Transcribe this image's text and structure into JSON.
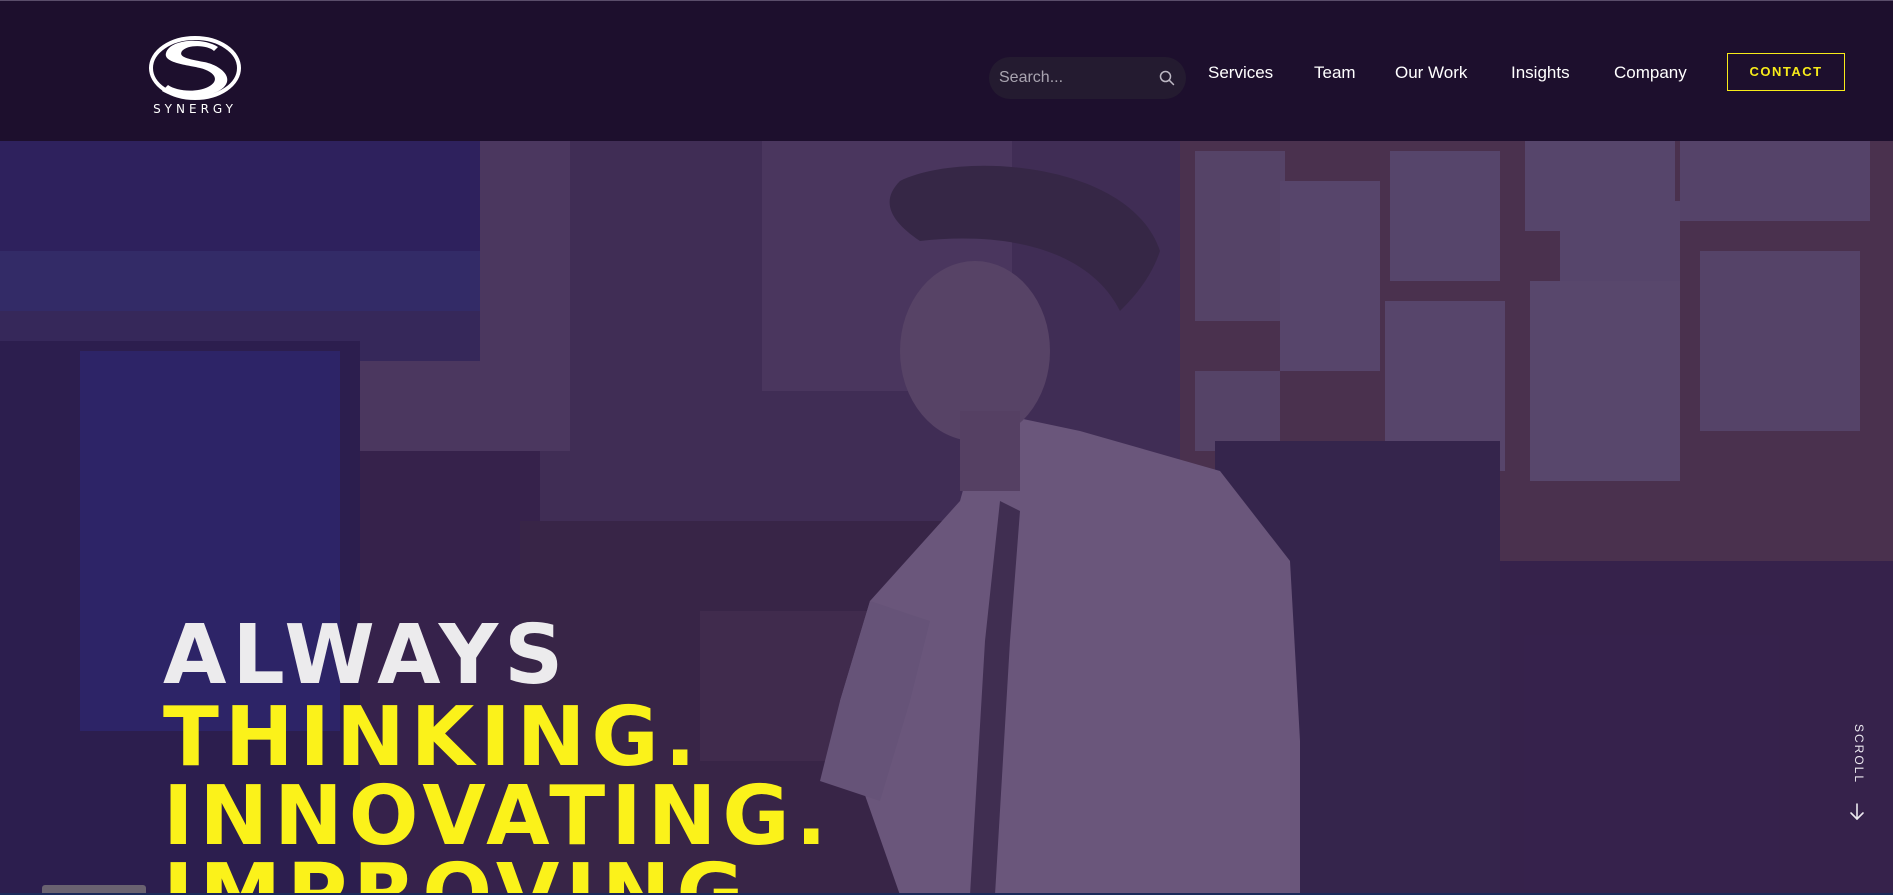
{
  "brand": {
    "name": "SYNERGY",
    "logo_icon": "synergy-swoosh-logo"
  },
  "search": {
    "placeholder": "Search...",
    "icon": "search-icon"
  },
  "nav": {
    "items": [
      {
        "label": "Services"
      },
      {
        "label": "Team"
      },
      {
        "label": "Our Work"
      },
      {
        "label": "Insights"
      },
      {
        "label": "Company"
      }
    ],
    "contact_label": "CONTACT"
  },
  "hero": {
    "line1": "ALWAYS",
    "line2": "THINKING.",
    "line3": "INNOVATING.",
    "line4": "IMPROVING.",
    "scroll_label": "SCROLL",
    "scroll_icon": "arrow-down-icon"
  },
  "colors": {
    "header_bg": "#1d0f2d",
    "accent_yellow": "#fbf21a",
    "hero_overlay": "#2d1046"
  }
}
